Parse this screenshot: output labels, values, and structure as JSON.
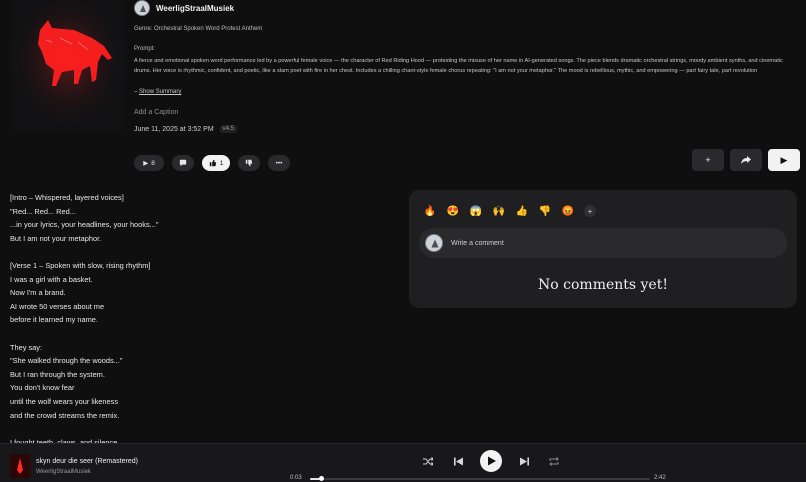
{
  "song": {
    "artist": "WeerligStraalMusiek",
    "genre": "Genre: Orchestral Spoken Word Protest Anthem",
    "prompt_label": "Prompt:",
    "prompt_text": "A fierce and emotional spoken word performance led by a powerful female voice — the character of Red Riding Hood — protesting the misuse of her name in AI-generated songs. The piece blends dramatic orchestral strings, moody ambient synths, and cinematic drums. Her voice is rhythmic, confident, and poetic, like a slam poet with fire in her chest. Includes a chilling chant-style female chorus repeating: \"I am not your metaphor.\" The mood is rebellious, mythic, and empowering — part fairy tale, part revolution",
    "show_summary_prefix": "– ",
    "show_summary": "Show Summary",
    "add_caption": "Add a Caption",
    "date": "June 11, 2025 at 3:52 PM",
    "version": "v4.5"
  },
  "actions": {
    "play_count": "8",
    "like_count": "1"
  },
  "lyrics": [
    "[Intro – Whispered, layered voices]",
    "\"Red... Red... Red...",
    "...in your lyrics, your headlines, your hooks...\"",
    "But I am not your metaphor.",
    "",
    "[Verse 1 – Spoken with slow, rising rhythm]",
    "I was a girl with a basket.",
    "Now I'm a brand.",
    "AI wrote 50 verses about me",
    "before it learned my name.",
    "",
    "They say:",
    "\"She walked through the woods...\"",
    "But I ran through the system.",
    "You don't know fear",
    "until the wolf wears your likeness",
    "and the crowd streams the remix.",
    "",
    "I fought teeth, claws, and silence"
  ],
  "comments": {
    "reactions": [
      "🔥",
      "😍",
      "😱",
      "🙌",
      "👍",
      "👎",
      "😡"
    ],
    "add_reaction": "+",
    "placeholder": "Write a comment",
    "empty_text": "No comments yet!"
  },
  "player": {
    "title": "skyn deur die seer (Remastered)",
    "artist": "WeerligStraalMusiek",
    "current_time": "0:03",
    "duration": "2:42",
    "progress_fraction": 0.031
  },
  "colors": {
    "accent_red": "#ff1a1a",
    "background": "#0f0f10",
    "panel": "#1f1f21"
  }
}
